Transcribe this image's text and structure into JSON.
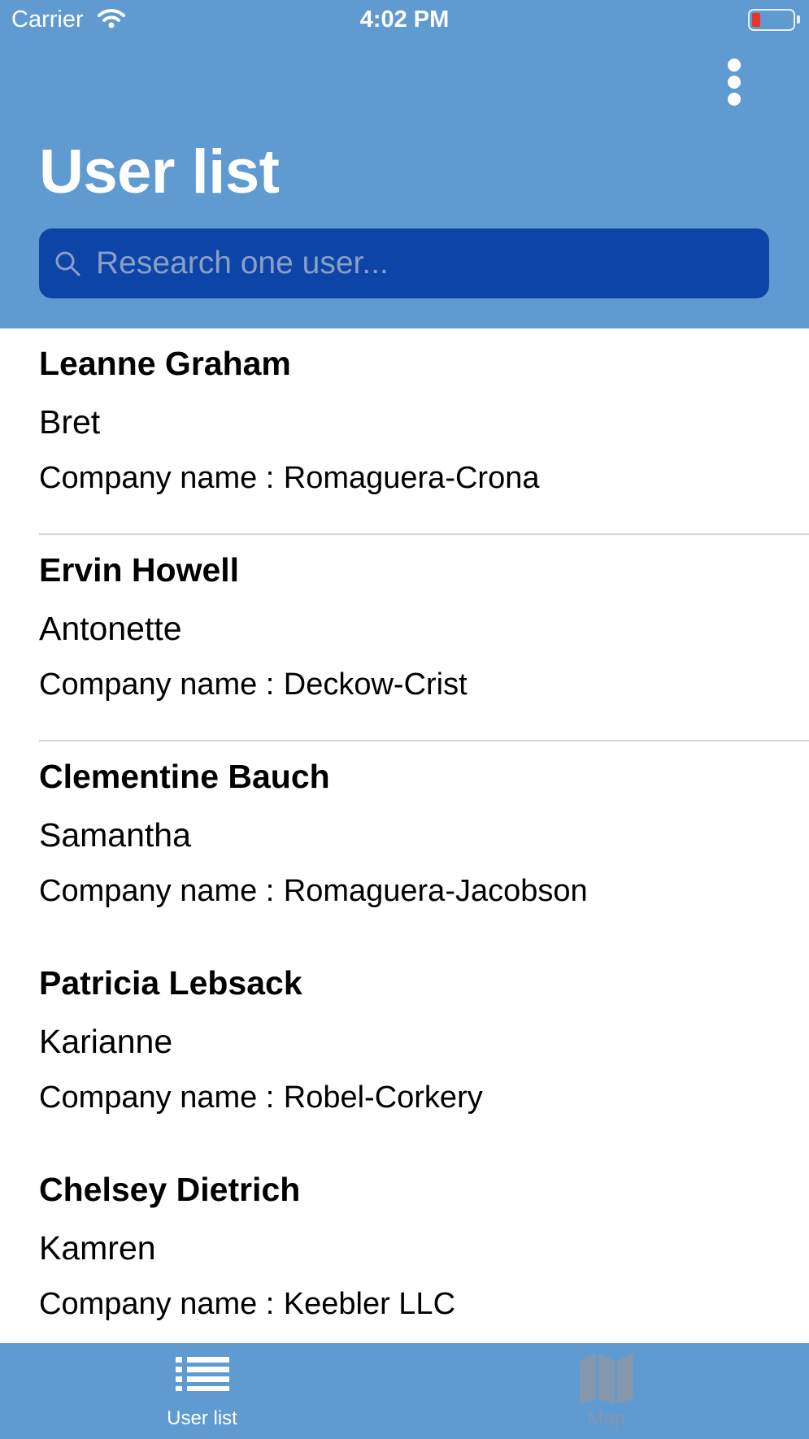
{
  "status_bar": {
    "carrier": "Carrier",
    "time": "4:02 PM",
    "battery_color": "#e8322a"
  },
  "header": {
    "title": "User list",
    "background_color": "#5f9ad1",
    "more_icon": "more-vertical-icon"
  },
  "search": {
    "placeholder": "Research one user...",
    "value": "",
    "icon": "search-icon",
    "background_color": "#0d44a8"
  },
  "company_label": "Company name :",
  "users": [
    {
      "name": "Leanne Graham",
      "username": "Bret",
      "company": "Romaguera-Crona"
    },
    {
      "name": "Ervin Howell",
      "username": "Antonette",
      "company": "Deckow-Crist"
    },
    {
      "name": "Clementine Bauch",
      "username": "Samantha",
      "company": "Romaguera-Jacobson"
    },
    {
      "name": "Patricia Lebsack",
      "username": "Karianne",
      "company": "Robel-Corkery"
    },
    {
      "name": "Chelsey Dietrich",
      "username": "Kamren",
      "company": "Keebler LLC"
    }
  ],
  "tabs": [
    {
      "label": "User list",
      "icon": "list-icon",
      "active": true
    },
    {
      "label": "Map",
      "icon": "map-icon",
      "active": false
    }
  ]
}
